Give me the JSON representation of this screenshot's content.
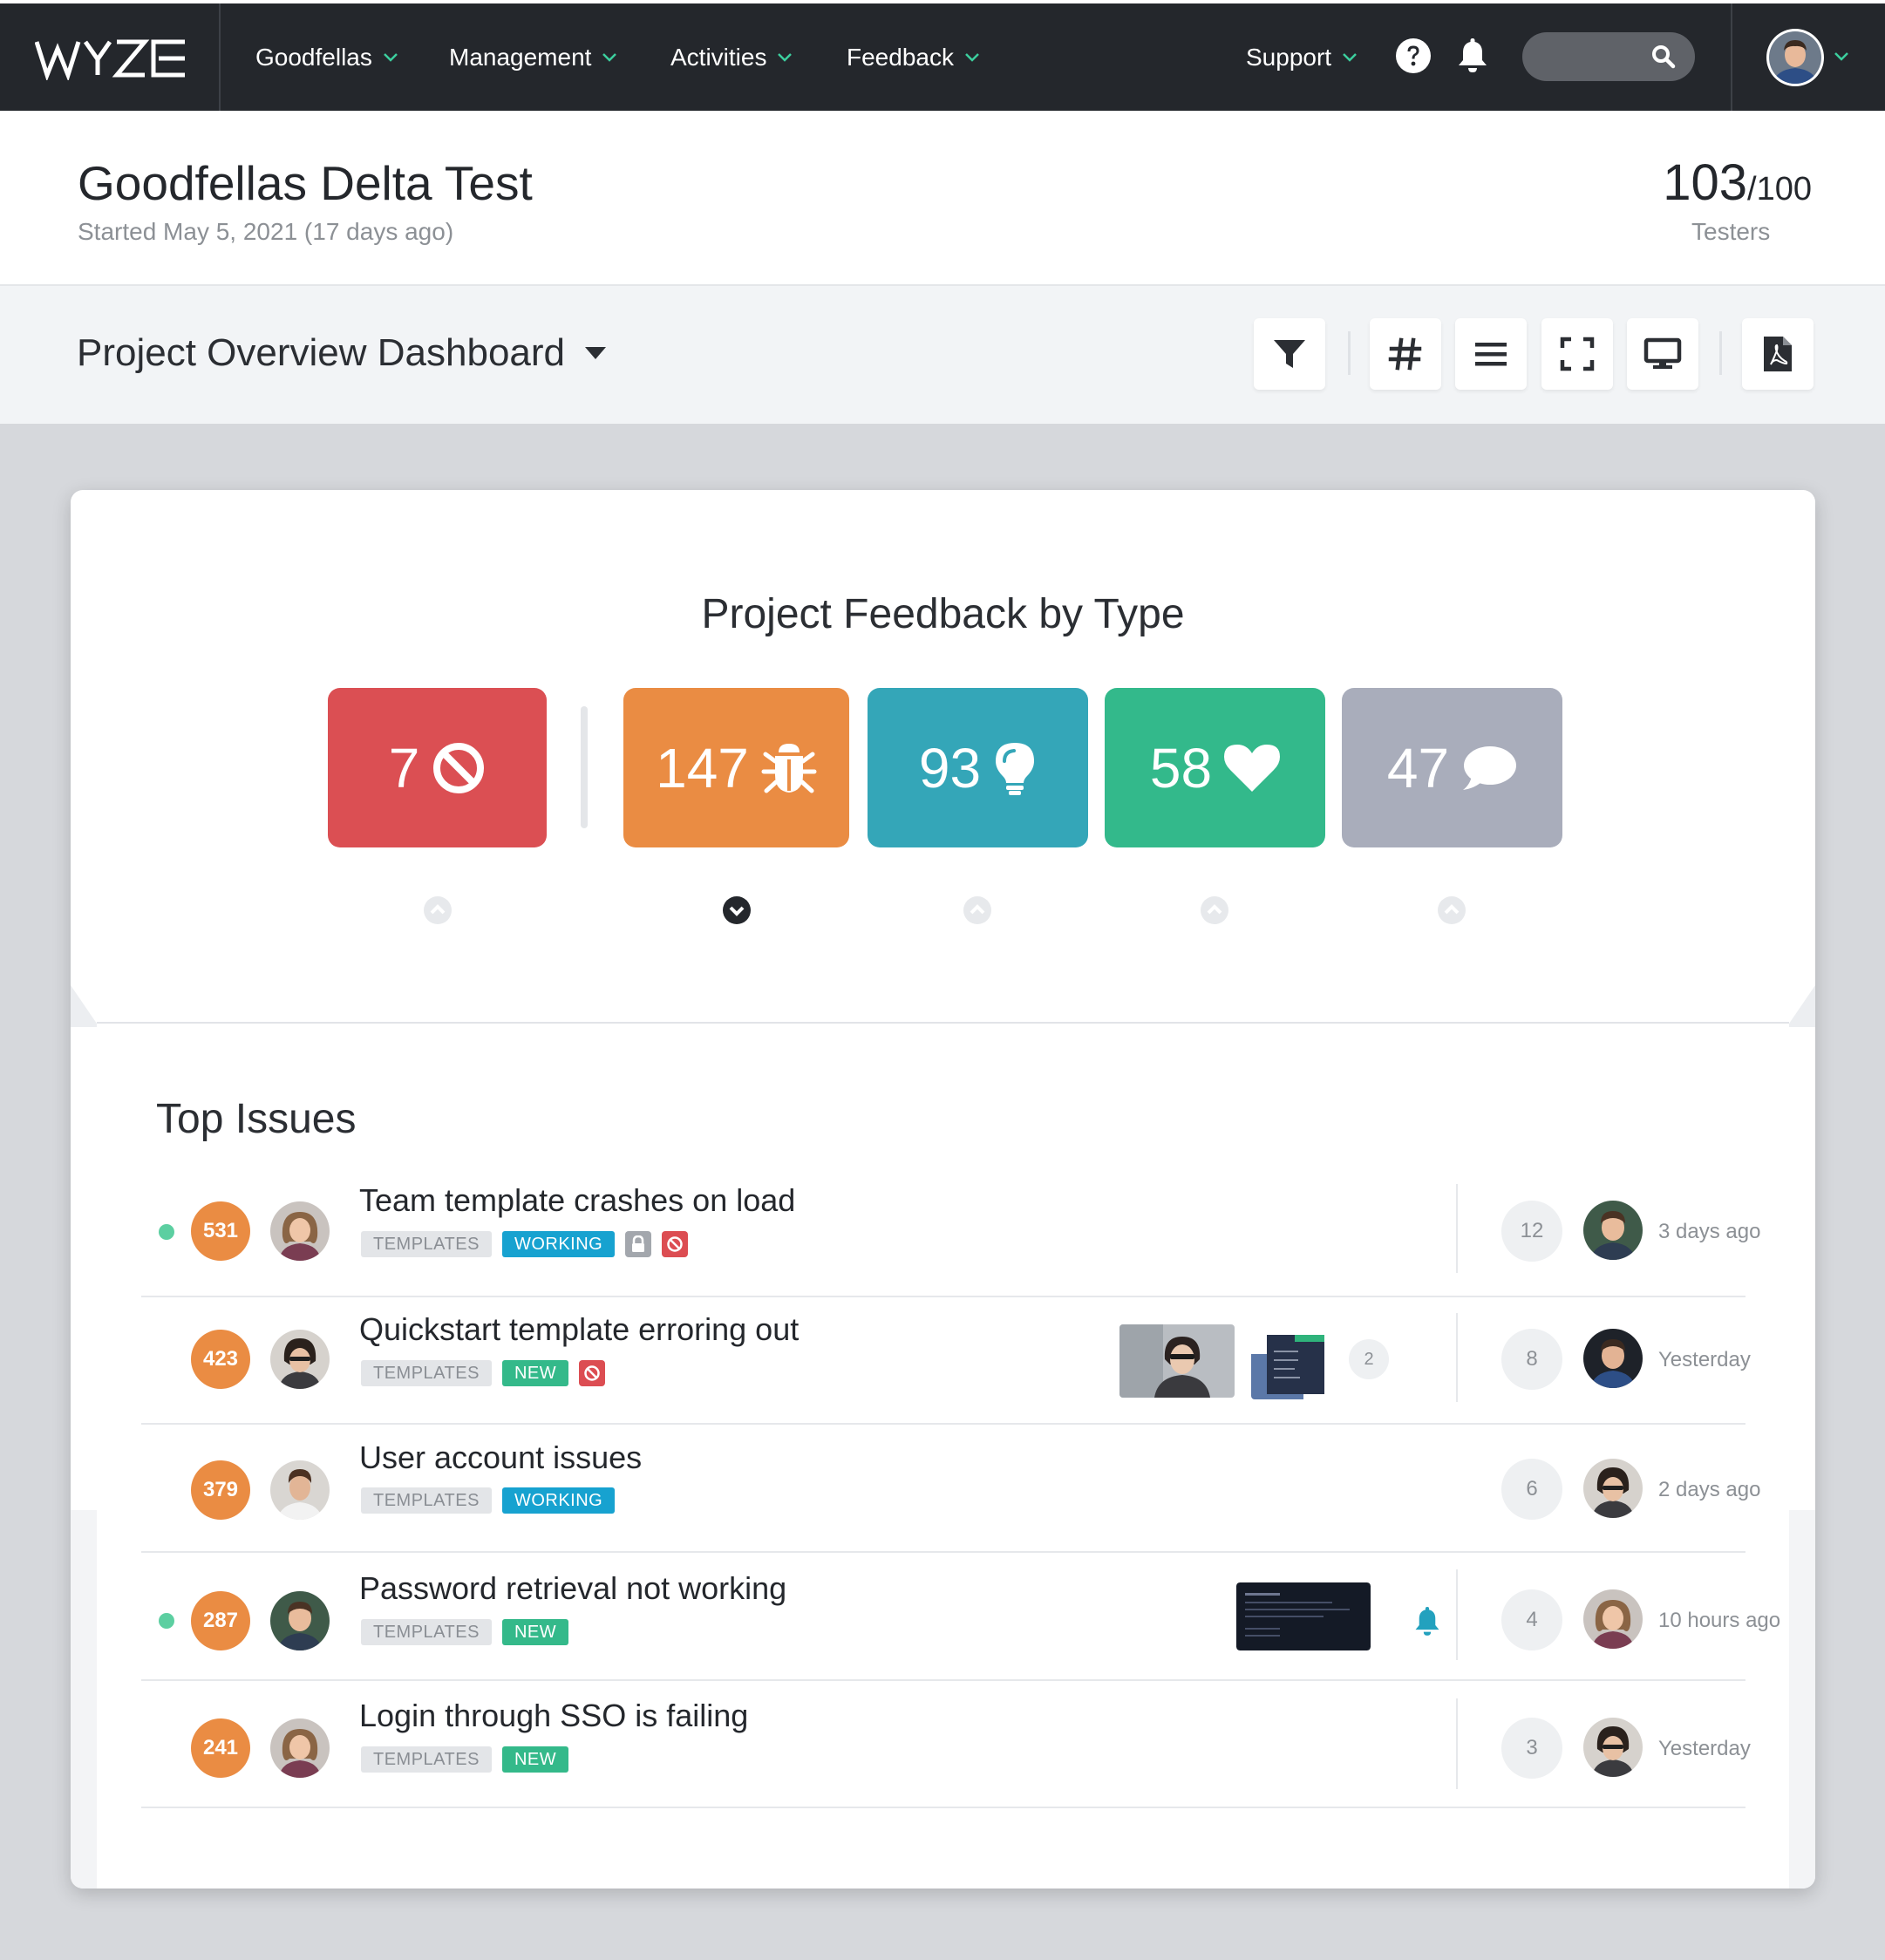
{
  "brand": {
    "logo": "WYZE"
  },
  "nav": {
    "items": [
      "Goodfellas",
      "Management",
      "Activities",
      "Feedback"
    ],
    "support": "Support",
    "search_placeholder": "",
    "icons": [
      "help-icon",
      "bell-icon",
      "search-icon"
    ]
  },
  "project": {
    "title": "Goodfellas Delta Test",
    "subtitle": "Started May 5, 2021 (17 days ago)",
    "testers_count": "103",
    "testers_total": "/100",
    "testers_label": "Testers"
  },
  "dashboard": {
    "title": "Project Overview Dashboard",
    "tools": [
      "filter-icon",
      "hashtag-icon",
      "list-icon",
      "fullscreen-icon",
      "monitor-icon",
      "pdf-icon"
    ]
  },
  "feedback_by_type": {
    "title": "Project Feedback by Type",
    "tiles": [
      {
        "value": "7",
        "icon": "block-icon",
        "color": "#db4f53"
      },
      {
        "value": "147",
        "icon": "bug-icon",
        "color": "#ea8c43"
      },
      {
        "value": "93",
        "icon": "lightbulb-icon",
        "color": "#34a6b8"
      },
      {
        "value": "58",
        "icon": "heart-icon",
        "color": "#33b98b"
      },
      {
        "value": "47",
        "icon": "comment-icon",
        "color": "#a9adbb"
      }
    ],
    "selected_index": 1
  },
  "top_issues": {
    "title": "Top Issues",
    "rows": [
      {
        "score": "531",
        "title": "Team template crashes on load",
        "tags": [
          "TEMPLATES",
          "WORKING"
        ],
        "count": "12",
        "time": "3 days ago"
      },
      {
        "score": "423",
        "title": "Quickstart template erroring out",
        "tags": [
          "TEMPLATES",
          "NEW"
        ],
        "attachments": "2",
        "count": "8",
        "time": "Yesterday"
      },
      {
        "score": "379",
        "title": "User account issues",
        "tags": [
          "TEMPLATES",
          "WORKING"
        ],
        "count": "6",
        "time": "2 days ago"
      },
      {
        "score": "287",
        "title": "Password retrieval not working",
        "tags": [
          "TEMPLATES",
          "NEW"
        ],
        "count": "4",
        "time": "10 hours ago"
      },
      {
        "score": "241",
        "title": "Login through SSO is failing",
        "tags": [
          "TEMPLATES",
          "NEW"
        ],
        "count": "3",
        "time": "Yesterday"
      }
    ]
  },
  "colors": {
    "accent_chevron": "#3ccf9e",
    "nav_bg": "#24272c",
    "score_orange": "#ea8c43"
  }
}
